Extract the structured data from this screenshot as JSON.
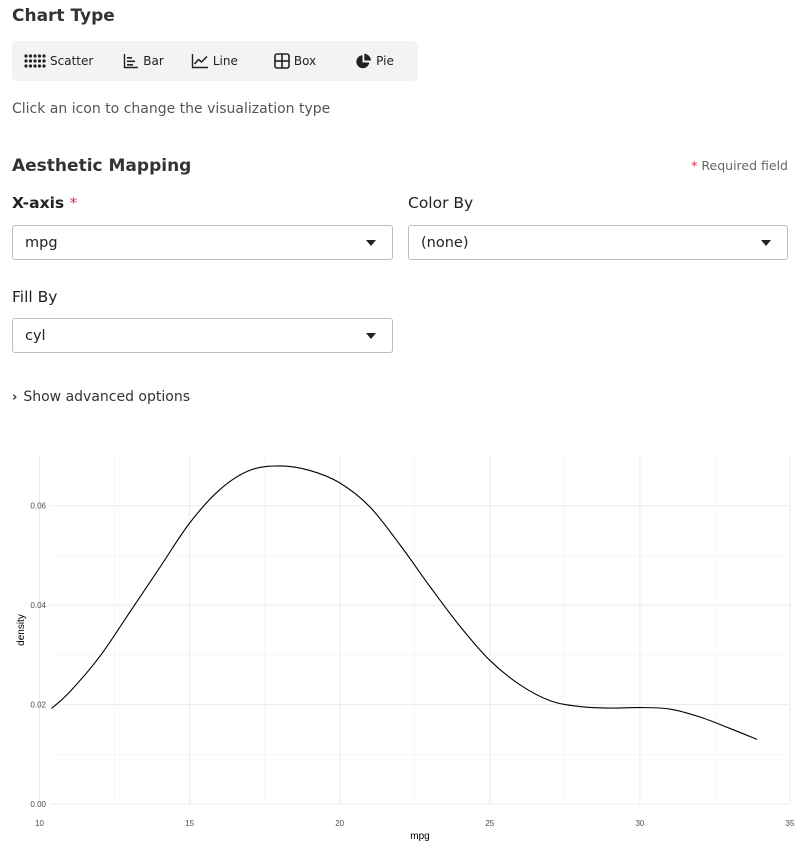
{
  "chart_type": {
    "heading": "Chart Type",
    "buttons": [
      {
        "id": "scatter",
        "label": "Scatter",
        "icon": "scatter-icon"
      },
      {
        "id": "bar",
        "label": "Bar",
        "icon": "bar-chart-icon"
      },
      {
        "id": "line",
        "label": "Line",
        "icon": "line-chart-icon"
      },
      {
        "id": "box",
        "label": "Box",
        "icon": "box-plot-icon"
      },
      {
        "id": "pie",
        "label": "Pie",
        "icon": "pie-chart-icon"
      }
    ],
    "hint": "Click an icon to change the visualization type"
  },
  "aesthetic": {
    "heading": "Aesthetic Mapping",
    "required_star": "*",
    "required_text": "Required field",
    "x_axis": {
      "label": "X-axis",
      "star": "*",
      "value": "mpg"
    },
    "color_by": {
      "label": "Color By",
      "value": "(none)"
    },
    "fill_by": {
      "label": "Fill By",
      "value": "cyl"
    }
  },
  "advanced": {
    "chevron": "›",
    "label": "Show advanced options"
  },
  "colors": {
    "required_star": "#d9314b",
    "toolbar_bg": "#f3f3f3",
    "grid": "#ebebeb"
  },
  "chart_data": {
    "type": "line",
    "subtype": "density",
    "title": "",
    "xlabel": "mpg",
    "ylabel": "density",
    "xlim": [
      10,
      35
    ],
    "ylim": [
      0,
      0.07
    ],
    "xticks": [
      10,
      15,
      20,
      25,
      30,
      35
    ],
    "yticks": [
      0.0,
      0.02,
      0.04,
      0.06
    ],
    "ytick_labels": [
      "0.00",
      "0.02",
      "0.04",
      "0.06"
    ],
    "grid": true,
    "legend": "none",
    "series": [
      {
        "x": [
          10.4,
          11,
          12,
          13,
          14,
          15,
          16,
          17,
          18,
          19,
          20,
          21,
          22,
          23,
          24,
          25,
          26,
          27,
          28,
          29,
          30,
          31,
          32,
          33,
          33.9
        ],
        "y": [
          0.0192,
          0.0225,
          0.0296,
          0.0385,
          0.0475,
          0.0565,
          0.0632,
          0.0671,
          0.068,
          0.0671,
          0.0646,
          0.0598,
          0.0522,
          0.0438,
          0.0358,
          0.0289,
          0.024,
          0.0208,
          0.0196,
          0.0193,
          0.0194,
          0.0191,
          0.0175,
          0.0152,
          0.013
        ]
      }
    ]
  }
}
